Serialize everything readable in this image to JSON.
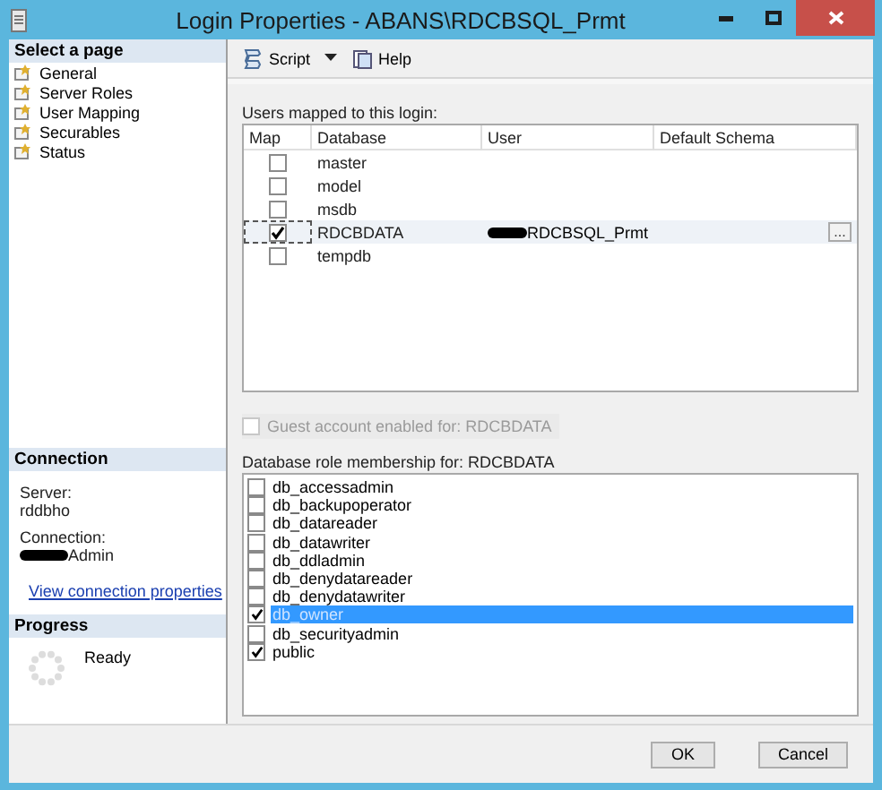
{
  "window": {
    "title": "Login Properties - ABANS\\RDCBSQL_Prmt"
  },
  "sidebar": {
    "header": "Select a page",
    "items": [
      {
        "label": "General"
      },
      {
        "label": "Server Roles"
      },
      {
        "label": "User Mapping"
      },
      {
        "label": "Securables"
      },
      {
        "label": "Status"
      }
    ]
  },
  "connection": {
    "header": "Connection",
    "server_label": "Server:",
    "server": "rddbho",
    "connection_label": "Connection:",
    "connection": "Admin",
    "link": "View connection properties"
  },
  "progress": {
    "header": "Progress",
    "status": "Ready"
  },
  "toolbar": {
    "items": [
      {
        "label": "Script",
        "dropdown": true
      },
      {
        "label": "Help",
        "dropdown": false
      }
    ]
  },
  "users_mapped": {
    "label": "Users mapped to this login:",
    "columns": [
      "Map",
      "Database",
      "User",
      "Default Schema"
    ],
    "rows": [
      {
        "checked": false,
        "database": "master",
        "selected": false
      },
      {
        "checked": false,
        "database": "model",
        "selected": false
      },
      {
        "checked": false,
        "database": "msdb",
        "selected": false
      },
      {
        "checked": true,
        "database": "RDCBDATA",
        "user": "RDCBSQL_Prmt",
        "schema_button": "...",
        "selected": true
      },
      {
        "checked": false,
        "database": "tempdb",
        "selected": false
      }
    ]
  },
  "guest": {
    "label": "Guest account enabled for: RDCBDATA",
    "checked": false,
    "disabled": true
  },
  "roles": {
    "label": "Database role membership for: RDCBDATA",
    "items": [
      {
        "name": "db_accessadmin",
        "checked": false,
        "selected": false
      },
      {
        "name": "db_backupoperator",
        "checked": false,
        "selected": false
      },
      {
        "name": "db_datareader",
        "checked": false,
        "selected": false
      },
      {
        "name": "db_datawriter",
        "checked": false,
        "selected": false
      },
      {
        "name": "db_ddladmin",
        "checked": false,
        "selected": false
      },
      {
        "name": "db_denydatareader",
        "checked": false,
        "selected": false
      },
      {
        "name": "db_denydatawriter",
        "checked": false,
        "selected": false
      },
      {
        "name": "db_owner",
        "checked": true,
        "selected": true
      },
      {
        "name": "db_securityadmin",
        "checked": false,
        "selected": false
      },
      {
        "name": "public",
        "checked": true,
        "selected": false
      }
    ]
  },
  "buttons": [
    "OK",
    "Cancel"
  ]
}
